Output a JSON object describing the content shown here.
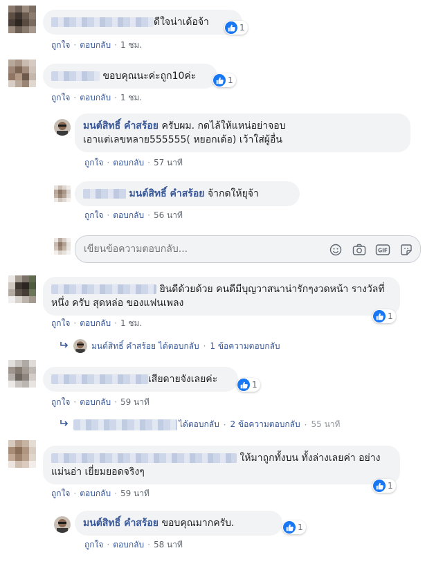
{
  "colors": {
    "link": "#385898",
    "meta": "#606770",
    "bubble": "#f2f3f5",
    "like": "#1877f2"
  },
  "actions": {
    "like": "ถูกใจ",
    "reply": "ตอบกลับ",
    "separator": "·"
  },
  "comments": [
    {
      "text": "ดีใจน่าเด้อจ้า",
      "likes": "1",
      "time": "1 ชม."
    },
    {
      "text": "ขอบคุณนะค่ะถูก10ค่ะ",
      "likes": "1",
      "time": "1 ชม."
    },
    {
      "text": "ยินดีด้วยด้วย คนดีมีบุญวาสนาน่ารักๆงวดหน้า รางวัลที่หนึ่ง ครับ สุดหล่อ ของแฟนเพลง",
      "likes": "1",
      "time": "1 ชม."
    },
    {
      "text": "เสียดายจังเลยค่ะ",
      "likes": "1",
      "time": "59 นาที"
    },
    {
      "text": "ให้มาถูกทั้งบน ทั้งล่างเลยค่า อย่างแม่นอ่า เยี่ยมยอดจริงๆ",
      "likes": "1",
      "time": "59 นาที"
    }
  ],
  "replies": [
    {
      "author": "มนต์สิทธิ์ คำสร้อย",
      "line1": "ครับผม. กดไล้ให้แหน่อย่าจอบ",
      "line2": "เอาแต่เลขหลาย555555( หยอกเด้อ) เว้าใส่ผู้อื่น",
      "time": "57 นาที"
    },
    {
      "author": "มนต์สิทธิ์ คำสร้อย",
      "text": "จ้ากดให้ยุจ้า",
      "time": "56 นาที"
    },
    {
      "author": "มนต์สิทธิ์ คำสร้อย",
      "text": "ขอบคุณมากครับ.",
      "likes": "1",
      "time": "58 นาที"
    }
  ],
  "reply_input": {
    "placeholder": "เขียนข้อความตอบกลับ..."
  },
  "reply_summaries": [
    {
      "author": "มนต์สิทธิ์ คำสร้อย",
      "action": "ได้ตอบกลับ",
      "count": "1 ข้อความตอบกลับ"
    },
    {
      "action": "ได้ตอบกลับ",
      "count": "2 ข้อความตอบกลับ",
      "time": "55 นาที"
    }
  ],
  "icons": [
    "thumbs-up-icon",
    "emoji-icon",
    "camera-icon",
    "gif-icon",
    "sticker-icon",
    "reply-arrow-icon"
  ]
}
